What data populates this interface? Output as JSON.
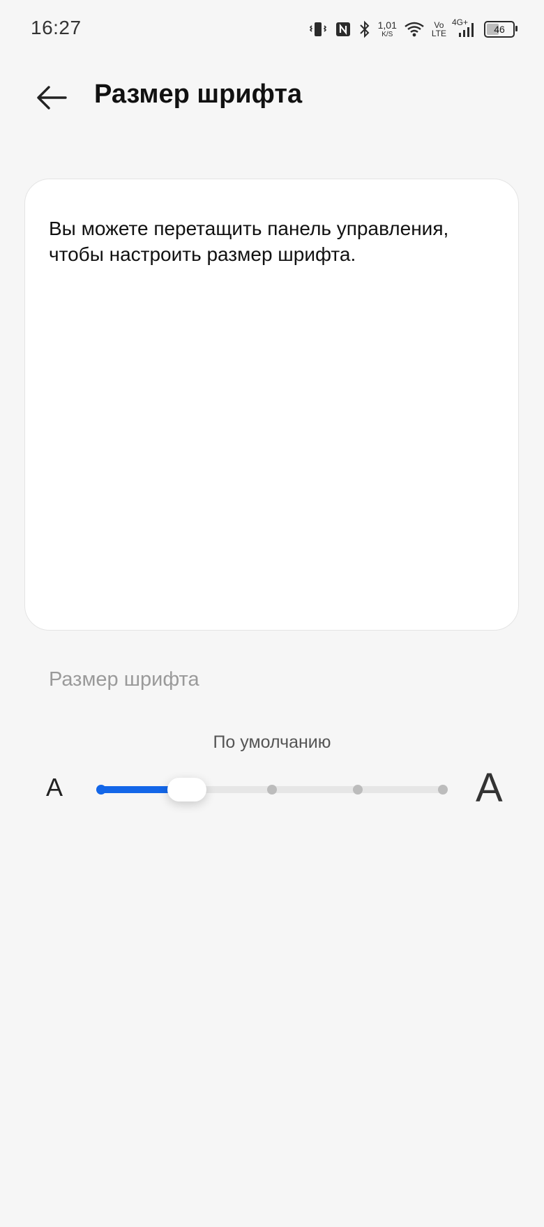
{
  "status_bar": {
    "time": "16:27",
    "icons": [
      "vibrate-icon",
      "nfc-icon",
      "bluetooth-icon",
      "wifi-icon",
      "signal-icon"
    ],
    "net_speed_value": "1,01",
    "net_speed_unit": "K/S",
    "volte_top": "Vo",
    "volte_bottom": "LTE",
    "network_type": "4G+",
    "battery_level": "46",
    "battery_fraction": 0.46
  },
  "header": {
    "back_icon": "arrow-left-icon",
    "title": "Размер шрифта"
  },
  "preview": {
    "text": "Вы можете перетащить панель управления, чтобы настроить размер шрифта."
  },
  "font_size": {
    "section_label": "Размер шрифта",
    "current_label": "По умолчанию",
    "small_glyph": "A",
    "large_glyph": "A",
    "steps": 5,
    "selected_index": 1,
    "accent_color": "#1366e8"
  }
}
